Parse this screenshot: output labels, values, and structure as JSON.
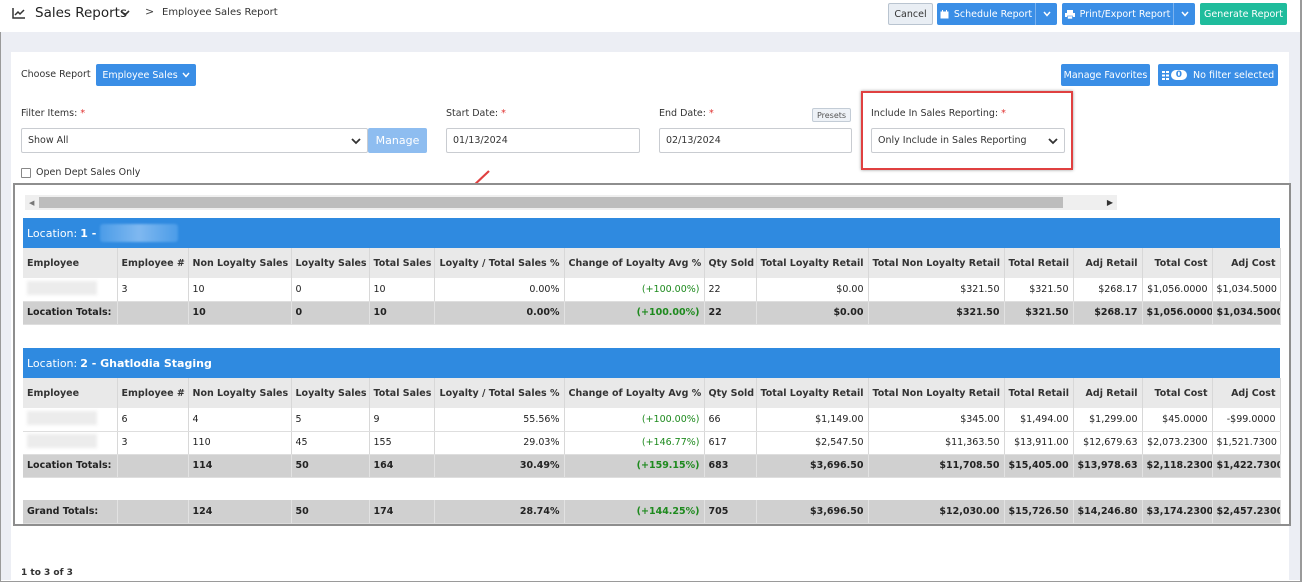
{
  "header": {
    "title": "Sales Reports",
    "breadcrumb_sep": ">",
    "breadcrumb_current": "Employee Sales Report",
    "cancel": "Cancel",
    "schedule": "Schedule Report",
    "print_export": "Print/Export Report",
    "generate": "Generate Report"
  },
  "toolbar": {
    "choose_report_label": "Choose Report",
    "report_selected": "Employee Sales",
    "manage_favorites": "Manage Favorites",
    "filter_count": "0",
    "filter_status": "No filter selected"
  },
  "filters": {
    "filter_items_label": "Filter Items:",
    "filter_items_value": "Show All",
    "manage_label": "Manage",
    "start_date_label": "Start Date:",
    "start_date_value": "01/13/2024",
    "end_date_label": "End Date:",
    "end_date_value": "02/13/2024",
    "presets_label": "Presets",
    "include_label": "Include In Sales Reporting:",
    "include_value": "Only Include in Sales Reporting",
    "open_dept_label": "Open Dept Sales Only",
    "required_mark": "*"
  },
  "columns": [
    "Employee",
    "Employee #",
    "Non Loyalty Sales",
    "Loyalty Sales",
    "Total Sales",
    "Loyalty / Total Sales %",
    "Change of Loyalty Avg %",
    "Qty Sold",
    "Total Loyalty Retail",
    "Total Non Loyalty Retail",
    "Total Retail",
    "Adj Retail",
    "Total Cost",
    "Adj Cost"
  ],
  "locations": [
    {
      "prefix": "Location:",
      "name": "1 -",
      "rows": [
        [
          "",
          "3",
          "10",
          "0",
          "10",
          "0.00%",
          "(+100.00%)",
          "22",
          "$0.00",
          "$321.50",
          "$321.50",
          "$268.17",
          "$1,056.0000",
          "$1,034.5000"
        ]
      ],
      "totals": [
        "Location Totals:",
        "",
        "10",
        "0",
        "10",
        "0.00%",
        "(+100.00%)",
        "22",
        "$0.00",
        "$321.50",
        "$321.50",
        "$268.17",
        "$1,056.0000",
        "$1,034.5000"
      ]
    },
    {
      "prefix": "Location:",
      "name": "2 - Ghatlodia Staging",
      "rows": [
        [
          "",
          "6",
          "4",
          "5",
          "9",
          "55.56%",
          "(+100.00%)",
          "66",
          "$1,149.00",
          "$345.00",
          "$1,494.00",
          "$1,299.00",
          "$45.0000",
          "-$99.0000"
        ],
        [
          "",
          "3",
          "110",
          "45",
          "155",
          "29.03%",
          "(+146.77%)",
          "617",
          "$2,547.50",
          "$11,363.50",
          "$13,911.00",
          "$12,679.63",
          "$2,073.2300",
          "$1,521.7300"
        ]
      ],
      "totals": [
        "Location Totals:",
        "",
        "114",
        "50",
        "164",
        "30.49%",
        "(+159.15%)",
        "683",
        "$3,696.50",
        "$11,708.50",
        "$15,405.00",
        "$13,978.63",
        "$2,118.2300",
        "$1,422.7300"
      ]
    }
  ],
  "grand_totals": [
    "Grand Totals:",
    "",
    "124",
    "50",
    "174",
    "28.74%",
    "(+144.25%)",
    "705",
    "$3,696.50",
    "$12,030.00",
    "$15,726.50",
    "$14,246.80",
    "$3,174.2300",
    "$2,457.2300"
  ],
  "pagination": "1 to 3 of 3",
  "colors": {
    "accent": "#3a8ee6",
    "generate": "#1fbc9c",
    "location_header": "#2f8ae0",
    "highlight": "#e04040",
    "positive": "#1e8a1e"
  }
}
